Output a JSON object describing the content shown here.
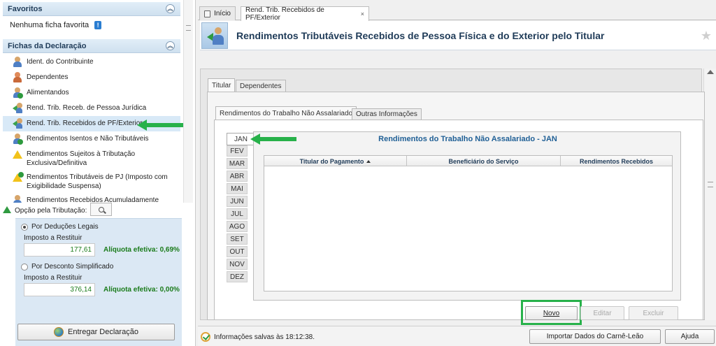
{
  "sidebar": {
    "favorites": {
      "title": "Favoritos",
      "empty_text": "Nenhuma ficha favorita"
    },
    "fichas": {
      "title": "Fichas da Declaração",
      "items": [
        {
          "label": "Ident. do Contribuinte",
          "icon": "person-icon"
        },
        {
          "label": "Dependentes",
          "icon": "people-icon"
        },
        {
          "label": "Alimentandos",
          "icon": "people-add-icon"
        },
        {
          "label": "Rend. Trib. Receb. de Pessoa Jurídica",
          "icon": "income-company-icon"
        },
        {
          "label": "Rend. Trib. Recebidos de PF/Exterior",
          "icon": "income-person-icon",
          "selected": true
        },
        {
          "label": "Rendimentos Isentos e Não Tributáveis",
          "icon": "income-exempt-icon"
        },
        {
          "label": "Rendimentos Sujeitos à Tributação Exclusiva/Definitiva",
          "icon": "warning-icon"
        },
        {
          "label": "Rendimentos Tributáveis de PJ (Imposto com Exigibilidade Suspensa)",
          "icon": "income-suspended-icon"
        },
        {
          "label": "Rendimentos Recebidos Acumuladamente",
          "icon": "income-accumulated-icon"
        }
      ]
    },
    "tributacao": {
      "title": "Opção pela Tributação:",
      "option1": {
        "label": "Por Deduções Legais",
        "selected": true,
        "imposto_label": "Imposto a Restituir",
        "value": "177,61",
        "aliquota": "Alíquota efetiva: 0,69%"
      },
      "option2": {
        "label": "Por Desconto Simplificado",
        "selected": false,
        "imposto_label": "Imposto a Restituir",
        "value": "376,14",
        "aliquota": "Alíquota efetiva: 0,00%"
      },
      "entregar_label": "Entregar Declaração"
    }
  },
  "tabs": [
    {
      "label": "Início",
      "icon": "home-icon"
    },
    {
      "label": "Rend. Trib. Recebidos de PF/Exterior",
      "close": "×",
      "active": true
    }
  ],
  "page": {
    "title": "Rendimentos Tributáveis Recebidos de Pessoa Física e do Exterior pelo Titular",
    "star": "★"
  },
  "subtabs_level1": [
    "Titular",
    "Dependentes"
  ],
  "subtabs_level2": [
    "Rendimentos do Trabalho Não Assalariado",
    "Outras Informações"
  ],
  "months": [
    "JAN",
    "FEV",
    "MAR",
    "ABR",
    "MAI",
    "JUN",
    "JUL",
    "AGO",
    "SET",
    "OUT",
    "NOV",
    "DEZ"
  ],
  "panel": {
    "title": "Rendimentos do Trabalho Não Assalariado - JAN",
    "columns": [
      "Titular do Pagamento",
      "Beneficiário do Serviço",
      "Rendimentos Recebidos"
    ]
  },
  "actions": {
    "novo": "Novo",
    "editar": "Editar",
    "excluir": "Excluir"
  },
  "status": {
    "message": "Informações salvas às 18:12:38.",
    "importar": "Importar Dados do Carnê-Leão",
    "ajuda": "Ajuda"
  },
  "colors": {
    "highlight": "#27b14a",
    "title": "#1f3b58",
    "value_green": "#1a7b1a"
  }
}
